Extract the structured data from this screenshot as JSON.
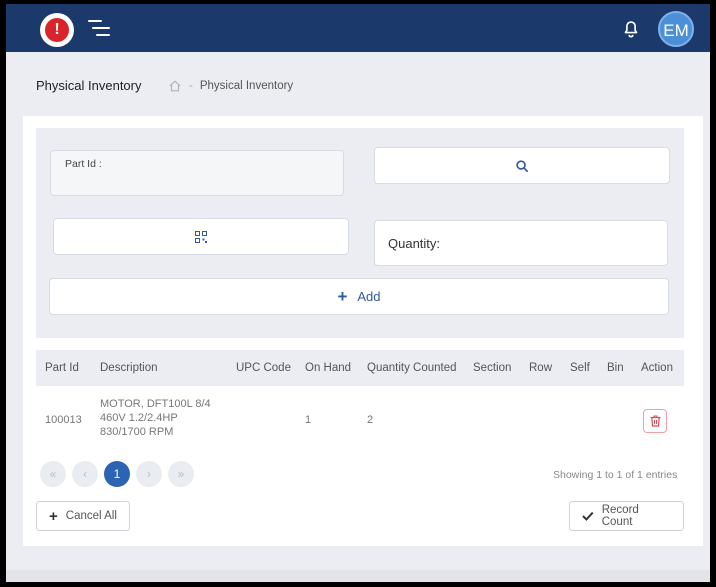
{
  "topbar": {
    "logo_glyph": "!",
    "avatar_initials": "EM",
    "icons": [
      "alert-logo-icon",
      "menu-icon",
      "bell-icon"
    ],
    "colors": {
      "bar": "#1b3a6b",
      "logo": "#d9242b",
      "avatar": "#4b8fd6"
    }
  },
  "header": {
    "title": "Physical Inventory",
    "breadcrumb": {
      "separator": "-",
      "current": "Physical Inventory"
    }
  },
  "form": {
    "part_id_label": "Part Id :",
    "quantity_label": "Quantity:",
    "add_label": "Add",
    "add_icon": "+"
  },
  "table": {
    "columns": [
      "Part Id",
      "Description",
      "UPC Code",
      "On Hand",
      "Quantity Counted",
      "Section",
      "Row",
      "Self",
      "Bin",
      "Action"
    ],
    "rows": [
      {
        "part_id": "100013",
        "description": [
          "MOTOR, DFT100L 8/4",
          "460V 1.2/2.4HP",
          "830/1700 RPM"
        ],
        "upc": "",
        "on_hand": "1",
        "quantity_counted": "2",
        "section": "",
        "row": "",
        "self": "",
        "bin": ""
      }
    ]
  },
  "pagination": {
    "first": "«",
    "prev": "‹",
    "current": "1",
    "next": "›",
    "last": "»",
    "showing": "Showing 1 to 1 of 1 entries"
  },
  "actions": {
    "cancel_all": "Cancel All",
    "record_count": "Record Count"
  }
}
